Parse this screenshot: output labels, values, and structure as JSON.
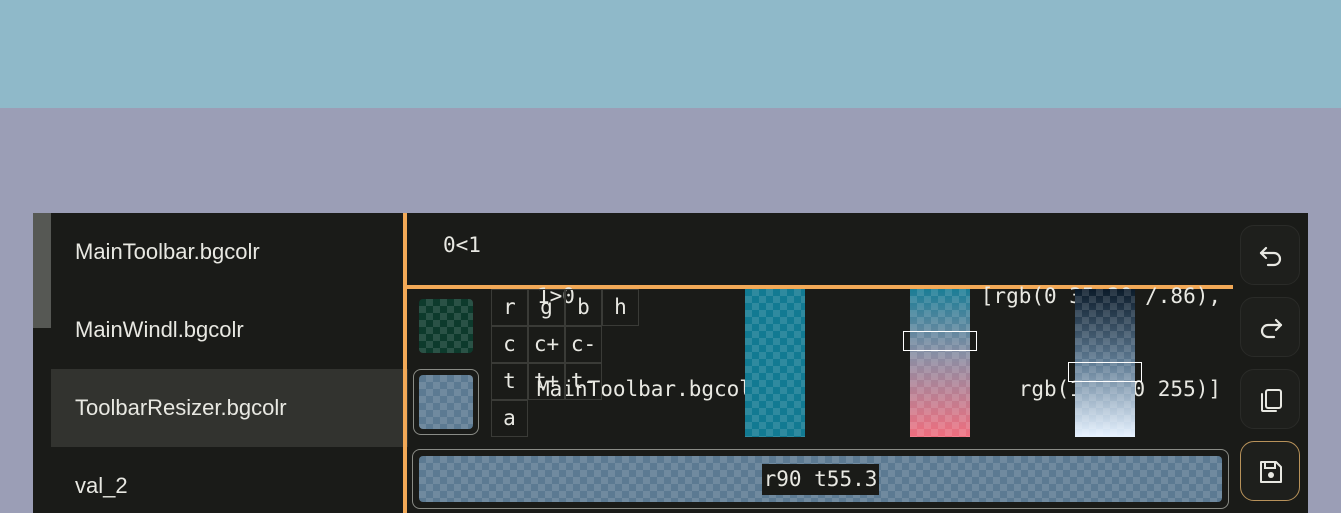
{
  "sidebar": {
    "items": [
      {
        "label": "MainToolbar.bgcolr"
      },
      {
        "label": "MainWindl.bgcolr"
      },
      {
        "label": "ToolbarResizer.bgcolr"
      },
      {
        "label": "val_2"
      }
    ],
    "selected_index": 2
  },
  "header": {
    "selection_indicator": "0<1",
    "name_line1": "1>0",
    "name_line2": "MainToolbar.bgcolr",
    "value_line1": "[rgb(0 35 20 /.86),",
    "value_line2": "rgb(10 200 255)]"
  },
  "editor": {
    "grid": [
      [
        "r",
        "g",
        "b",
        "h"
      ],
      [
        "c",
        "c+",
        "c-"
      ],
      [
        "t",
        "t+",
        "t-"
      ],
      [
        "a"
      ]
    ],
    "result_label": "r90 t55.3",
    "colors": {
      "swatch_start": "#0d3a2c",
      "swatch_current": "#5c7a92",
      "strip_hue": "#127a92",
      "accent": "#f2a957"
    }
  },
  "actions": {
    "icons": [
      "undo-icon",
      "redo-icon",
      "copy-icon",
      "save-icon"
    ]
  }
}
